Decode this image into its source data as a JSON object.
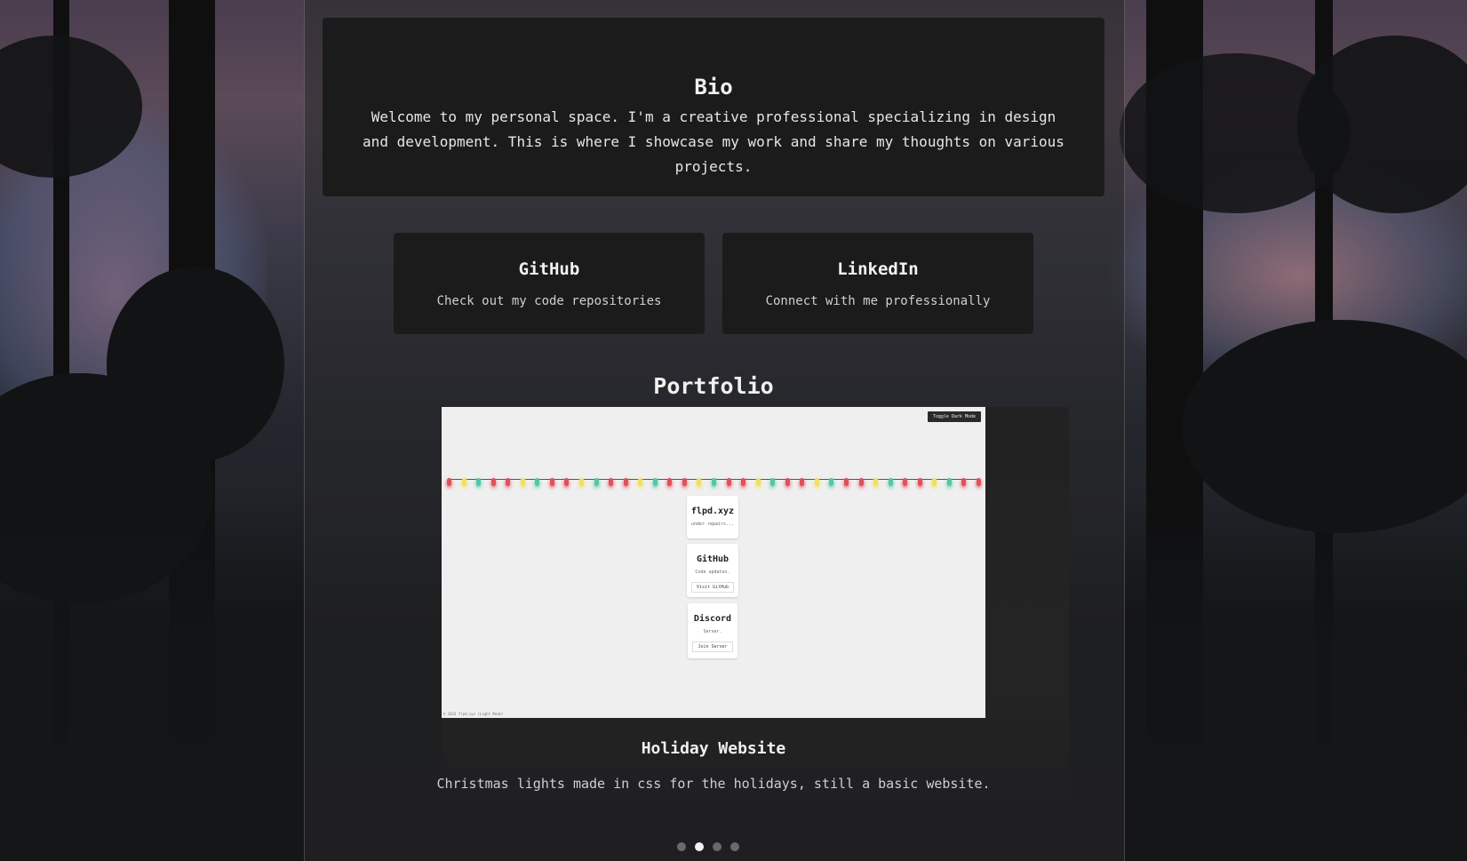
{
  "bio": {
    "title": "Bio",
    "text": "Welcome to my personal space. I'm a creative professional specializing in design and development. This is where I showcase my work and share my thoughts on various projects."
  },
  "links": [
    {
      "title": "GitHub",
      "description": "Check out my code repositories"
    },
    {
      "title": "LinkedIn",
      "description": "Connect with me professionally"
    }
  ],
  "portfolio": {
    "title": "Portfolio",
    "current_item": {
      "title": "Holiday Website",
      "description": "Christmas lights made in css for the holidays, still a basic website.",
      "screenshot": {
        "toggle_label": "Toggle Dark Mode",
        "cards": [
          {
            "title": "flpd.xyz",
            "subtitle": "under repairs...",
            "button": ""
          },
          {
            "title": "GitHub",
            "subtitle": "Code updates.",
            "button": "Visit GitHub"
          },
          {
            "title": "Discord",
            "subtitle": "Server.",
            "button": "Join Server"
          }
        ],
        "footer": "© 2024 flpd.xyz (Light Mode)"
      }
    },
    "carousel": {
      "total": 4,
      "active_index": 1
    }
  },
  "colors": {
    "card_bg": "#1b1b1b",
    "dot_active": "#f2f2f2",
    "dot_inactive": "#6a6a6a",
    "bulbs": [
      "#e0505a",
      "#f0e060",
      "#50c8a8",
      "#e0505a"
    ]
  }
}
